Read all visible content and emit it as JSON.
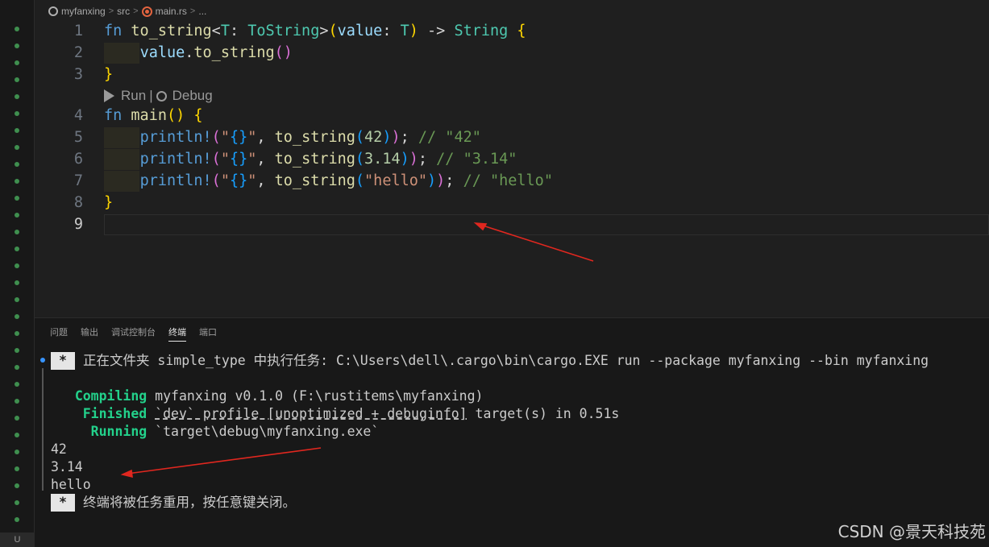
{
  "breadcrumb": {
    "project": "myfanxing",
    "folder": "src",
    "file": "main.rs",
    "more": "..."
  },
  "editor": {
    "line_numbers": [
      "1",
      "2",
      "3",
      "4",
      "5",
      "6",
      "7",
      "8",
      "9"
    ],
    "codelens": {
      "run": "Run",
      "separator": "|",
      "debug": "Debug"
    }
  },
  "panel": {
    "tabs": [
      "问题",
      "输出",
      "调试控制台",
      "终端",
      "端口"
    ],
    "active_tab": "终端"
  },
  "terminal": {
    "star": "*",
    "task_line": "正在文件夹 simple_type 中执行任务: C:\\Users\\dell\\.cargo\\bin\\cargo.EXE run --package myfanxing --bin myfanxing",
    "compiling_label": "Compiling",
    "compiling_text": "myfanxing v0.1.0 (F:\\rustitems\\myfanxing)",
    "finished_label": "Finished",
    "finished_profile": "`dev` profile [unoptimized + debuginfo]",
    "finished_rest": " target(s) in 0.51s",
    "running_label": "Running",
    "running_text": "`target\\debug\\myfanxing.exe`",
    "outputs": [
      "42",
      "3.14",
      "hello"
    ],
    "reuse_line": "终端将被任务重用，按任意键关闭。"
  },
  "watermark": "CSDN @景天科技苑",
  "colors": {
    "editor_bg": "#1f1f1f",
    "panel_bg": "#181818",
    "keyword": "#569cd6",
    "function": "#dcdcaa",
    "type": "#4ec9b0",
    "string": "#ce9178",
    "number": "#b5cea8",
    "comment": "#6a9955",
    "terminal_green": "#23d18b",
    "arrow": "#e0271f"
  }
}
